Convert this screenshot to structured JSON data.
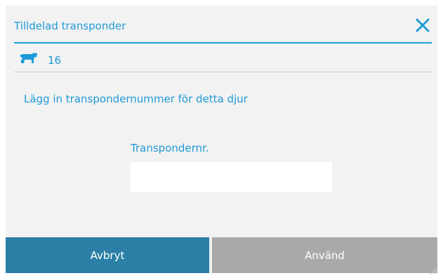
{
  "dialog": {
    "title": "Tilldelad transponder",
    "animal_number": "16",
    "instruction": "Lägg in transpondernummer för detta djur",
    "field": {
      "label": "Transpondernr.",
      "value": "",
      "placeholder": ""
    },
    "buttons": {
      "cancel": "Avbryt",
      "apply": "Använd"
    },
    "icons": {
      "close": "close-icon",
      "animal": "cow-icon"
    },
    "colors": {
      "accent": "#1e9bd7",
      "cancel_bg": "#2b7fa6",
      "apply_bg": "#a9a9a9",
      "dialog_bg": "#f2f2f2"
    }
  }
}
